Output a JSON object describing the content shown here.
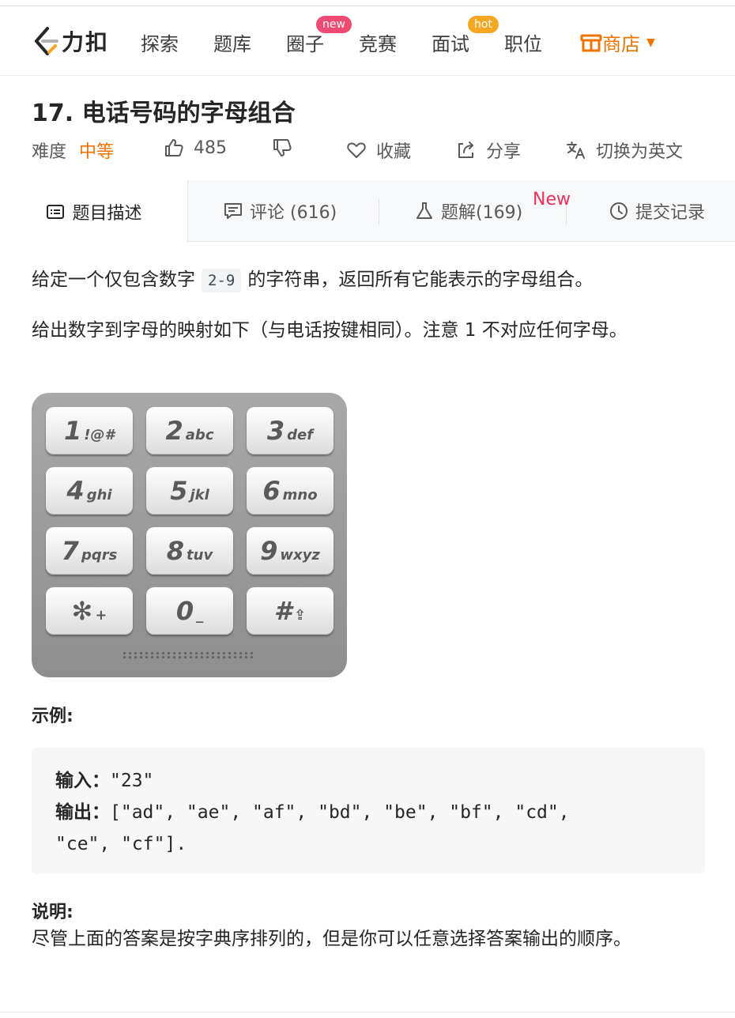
{
  "navbar": {
    "logo_text": "力扣",
    "items": [
      "探索",
      "题库",
      "圈子",
      "竞赛",
      "面试",
      "职位"
    ],
    "badges": {
      "circle": "new",
      "interview": "hot"
    },
    "shop_label": "商店",
    "accent_color": "#f07300"
  },
  "problem": {
    "title": "17. 电话号码的字母组合",
    "difficulty_label": "难度",
    "difficulty_value": "中等",
    "likes": "485",
    "favorite_label": "收藏",
    "share_label": "分享",
    "translate_label": "切换为英文"
  },
  "tabs": {
    "description": "题目描述",
    "comments": "评论 (616)",
    "solutions": "题解(169)",
    "solutions_badge": "New",
    "submissions": "提交记录"
  },
  "content": {
    "p1_before": "给定一个仅包含数字",
    "p1_code": "2-9",
    "p1_after": "的字符串，返回所有它能表示的字母组合。",
    "p2": "给出数字到字母的映射如下（与电话按键相同）。注意 1 不对应任何字母。",
    "keys": [
      {
        "d": "1",
        "l": "!@#"
      },
      {
        "d": "2",
        "l": "abc"
      },
      {
        "d": "3",
        "l": "def"
      },
      {
        "d": "4",
        "l": "ghi"
      },
      {
        "d": "5",
        "l": "jkl"
      },
      {
        "d": "6",
        "l": "mno"
      },
      {
        "d": "7",
        "l": "pqrs"
      },
      {
        "d": "8",
        "l": "tuv"
      },
      {
        "d": "9",
        "l": "wxyz"
      },
      {
        "d": "✻",
        "l": "+"
      },
      {
        "d": "0",
        "l": "_"
      },
      {
        "d": "#",
        "l": "⇪"
      }
    ],
    "example_label": "示例:",
    "example_input_label": "输入",
    "example_input": "\"23\"",
    "example_output_label": "输出",
    "example_output_line1": "[\"ad\", \"ae\", \"af\", \"bd\", \"be\", \"bf\", \"cd\",",
    "example_output_line2": "\"ce\", \"cf\"].",
    "note_label": "说明:",
    "note_text": "尽管上面的答案是按字典序排列的，但是你可以任意选择答案输出的顺序。"
  }
}
